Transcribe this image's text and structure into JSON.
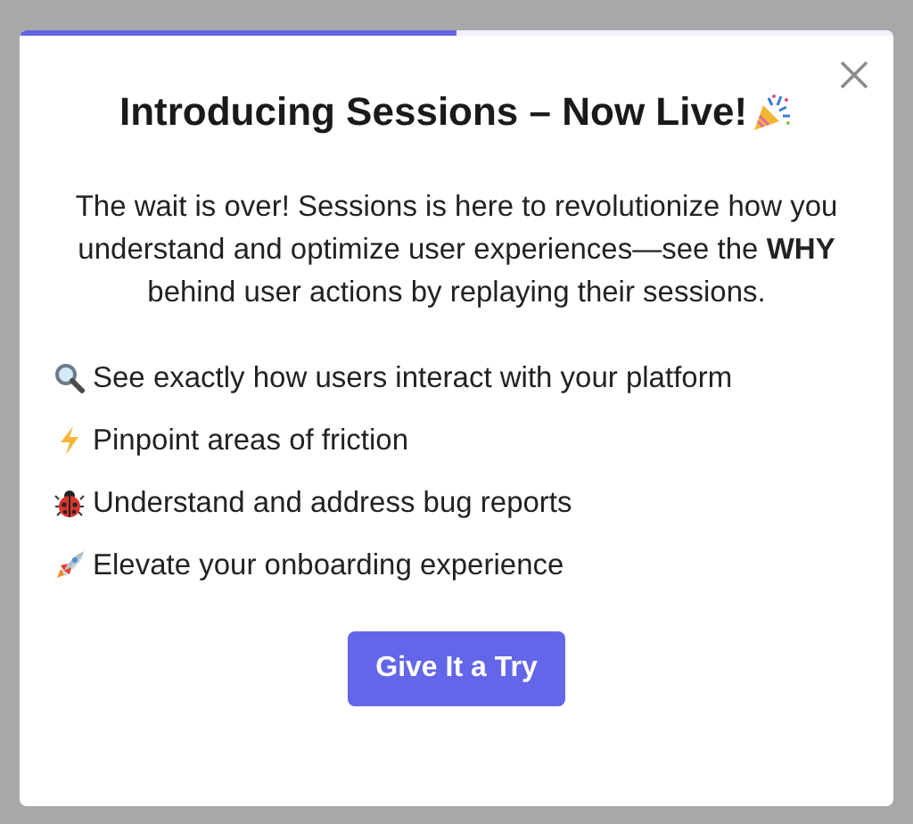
{
  "progress": {
    "level": 0.5
  },
  "title": "Introducing Sessions – Now Live!",
  "description": "The wait is over! Sessions is here to revolutionize how you understand and optimize user experiences—see the **WHY** behind user actions by replaying their sessions.",
  "features": [
    {
      "kind": "search",
      "text": "See exactly how users interact with your platform"
    },
    {
      "kind": "lightning",
      "text": "Pinpoint areas of friction"
    },
    {
      "kind": "ladybug",
      "text": "Understand and address bug reports"
    },
    {
      "kind": "rocket",
      "text": "Elevate your onboarding experience"
    }
  ],
  "button": "Give It a Try"
}
